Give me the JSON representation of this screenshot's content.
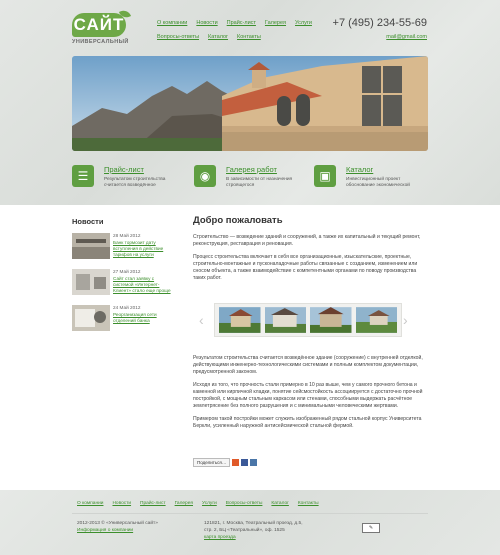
{
  "logo": {
    "badge": "САЙТ",
    "sub": "УНИВЕРСАЛЬНЫЙ"
  },
  "topnav": {
    "row1": [
      "О компании",
      "Новости",
      "Прайс-лист",
      "Галерея",
      "Услуги"
    ],
    "row2": [
      "Вопросы-ответы",
      "Каталог",
      "Контакты"
    ]
  },
  "contact": {
    "phone": "+7 (495) 234-55-69",
    "email": "mail@gmail.com"
  },
  "features": [
    {
      "icon": "list-icon",
      "title": "Прайс-лист",
      "desc": "Результатом строительства считается возведённое"
    },
    {
      "icon": "camera-icon",
      "title": "Галерея работ",
      "desc": "В зависимости от назначения строящегося"
    },
    {
      "icon": "briefcase-icon",
      "title": "Каталог",
      "desc": "Инвестиционный проект обоснование экономической"
    }
  ],
  "sidebar": {
    "title": "Новости",
    "news": [
      {
        "date": "28 Май 2012",
        "text": "Банк тормозит дату вступления в действие тарифов на услуги"
      },
      {
        "date": "27 Май 2012",
        "text": "Сайт стал заявку с системой «Интернет-Клиент» стало еще проще"
      },
      {
        "date": "24 Май 2012",
        "text": "Реорганизация сети отделений банка"
      }
    ]
  },
  "main": {
    "title": "Добро пожаловать",
    "p1": "Строительство — возведение зданий и сооружений, а также их капитальный и текущий ремонт, реконструкция, реставрация и реновация.",
    "p2": "Процесс строительства включает в себя все организационные, изыскательские, проектные, строительно-монтажные и пусконаладочные работы связанные с созданием, изменением или сносом объекта, а также взаимодействие с компетентными органами по поводу производства таких работ.",
    "p3": "Результатом строительства считается возведённое здание (сооружение) с внутренней отделкой, действующими инженерно-технологическими системами и полным комплектом документации, предусмотренной законом.",
    "p4": "Исходя из того, что прочность стали примерно в 10 раз выше, чем у самого прочного бетона и каменной или кирпичной кладки, понятие сейсмостойкость ассоциируется с достаточно прочной постройкой, с мощным стальным каркасом или стенами, способными выдержать расчётное землетрясение без полного разрушения и с минимальными человеческими жертвами.",
    "p5": "Примером такой постройки может служить изображенный рядом стальной корпус Университета Беркли, усиленный наружной антисейсмической стальной фермой.",
    "share": "Поделиться…"
  },
  "gallery": {
    "arrow_left": "‹",
    "arrow_right": "›"
  },
  "footer": {
    "nav": [
      "О компании",
      "Новости",
      "Прайс-лист",
      "Галерея",
      "Услуги",
      "Вопросы-ответы",
      "Каталог",
      "Контакты"
    ],
    "copy": "2012-2013 © «Универсальный сайт»",
    "info_link": "Информация о компании",
    "address": "121821, г. Москва, Театральный проезд, д.5, стр. 2, БЦ «Театральный», оф. 1525",
    "map_link": "карта проезда",
    "badge": "✎"
  },
  "colors": {
    "accent": "#3c8f2c",
    "logo": "#6ea847",
    "icon_bg": "#5f9e41"
  }
}
